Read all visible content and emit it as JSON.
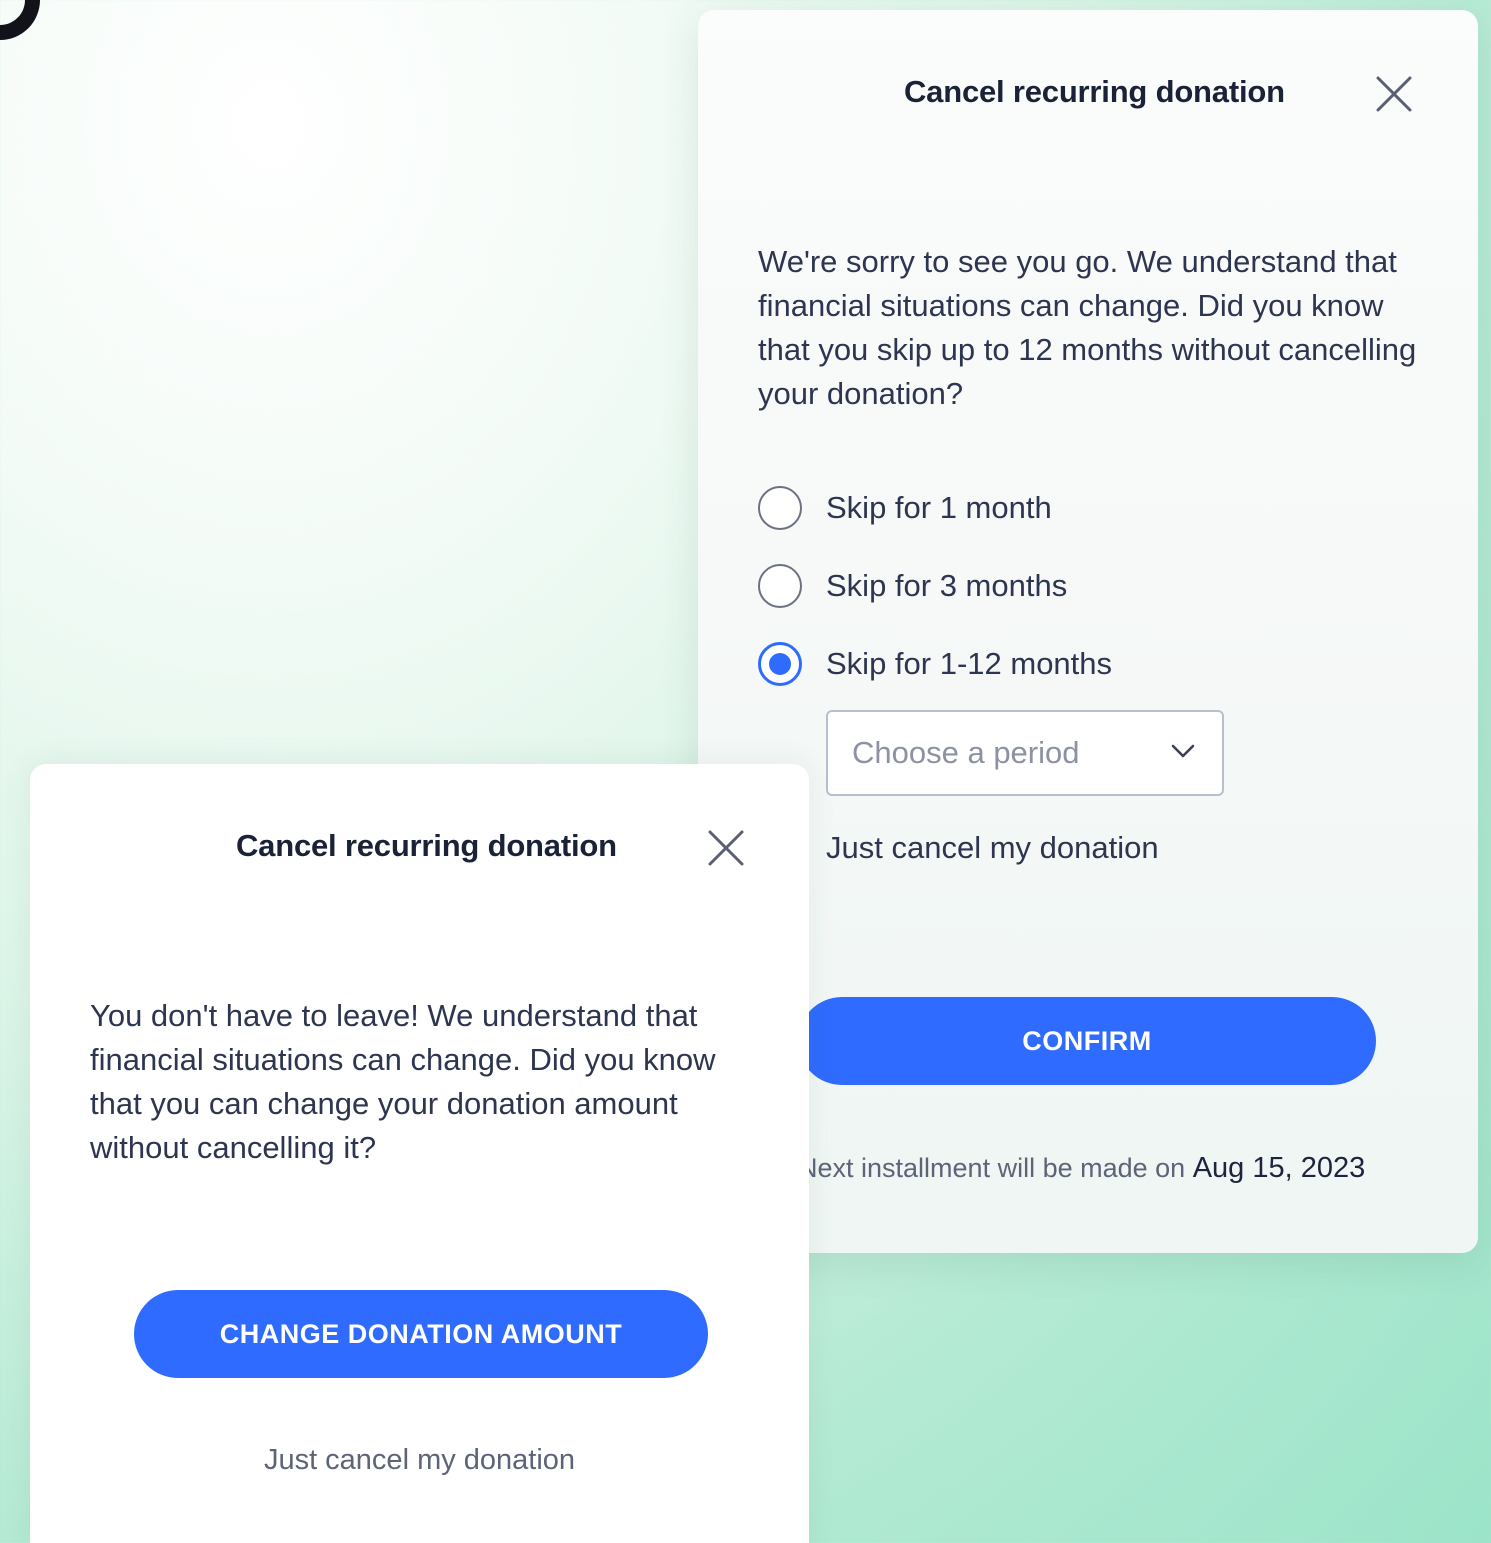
{
  "colors": {
    "accent": "#2f6bff",
    "text_dark": "#1a2238",
    "text_muted": "#5d6478"
  },
  "back_modal": {
    "title": "Cancel recurring donation",
    "close_icon": "close-icon",
    "message": "We're sorry to see you go. We understand that financial situations can change. Did you know that you skip up to 12 months without cancelling your donation?",
    "options": [
      {
        "label": "Skip for 1 month",
        "checked": false
      },
      {
        "label": "Skip for 3 months",
        "checked": false
      },
      {
        "label": "Skip for 1-12 months",
        "checked": true
      }
    ],
    "select": {
      "placeholder": "Choose a period",
      "chevron_icon": "chevron-down-icon"
    },
    "cancel_link": "Just cancel my donation",
    "confirm_label": "CONFIRM",
    "installment_prefix": "Next installment will be made on",
    "installment_date": "Aug 15, 2023"
  },
  "front_modal": {
    "title": "Cancel recurring donation",
    "close_icon": "close-icon",
    "message": "You don't have to leave! We understand that financial situations can change. Did you know that you can change your donation amount without cancelling it?",
    "change_label": "CHANGE DONATION AMOUNT",
    "cancel_link": "Just cancel my donation"
  }
}
